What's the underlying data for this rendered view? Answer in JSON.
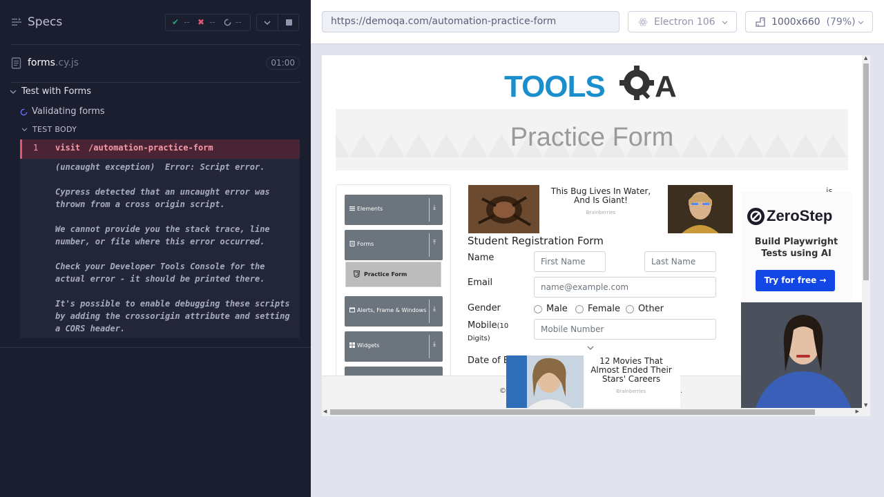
{
  "reporter": {
    "title": "Specs",
    "stats": {
      "passed": "--",
      "failed": "--",
      "pending": "--"
    },
    "spec": {
      "name": "forms",
      "ext": ".cy.js",
      "duration": "01:00"
    },
    "suite": "Test with Forms",
    "test": "Validating forms",
    "test_body": "TEST BODY",
    "command": {
      "number": "1",
      "name": "visit",
      "message": "/automation-practice-form"
    },
    "error_lines": [
      "(uncaught exception)  Error: Script error.",
      "Cypress detected that an uncaught error was\nthrown from a cross origin script.",
      "We cannot provide you the stack trace, line\nnumber, or file where this error occurred.",
      "Check your Developer Tools Console for the\nactual error - it should be printed there.",
      "It's possible to enable debugging these scripts\nby adding the crossorigin attribute and setting\na CORS header."
    ]
  },
  "aut": {
    "url": "https://demoqa.com/automation-practice-form",
    "browser": "Electron 106",
    "viewport": "1000x660",
    "zoom": "(79%)"
  },
  "page": {
    "logo_text": "TOOLSQA",
    "heading": "Practice Form",
    "nav": {
      "elements": "Elements",
      "forms": "Forms",
      "practice_form": "Practice Form",
      "alerts": "Alerts, Frame & Windows",
      "widgets": "Widgets"
    },
    "ads": {
      "bug_title": "This Bug Lives In Water, And Is Giant!",
      "bug_source": "Brainberries",
      "partial_title": "is\ns",
      "movies_title": "12 Movies That Almost Ended Their Stars' Careers",
      "movies_source": "Brainberries",
      "zerostep_name": "ZeroStep",
      "zerostep_tag": "Build Playwright Tests using AI",
      "zerostep_cta": "Try for free →"
    },
    "form": {
      "title": "Student Registration Form",
      "name_label": "Name",
      "first_name_ph": "First Name",
      "last_name_ph": "Last Name",
      "email_label": "Email",
      "email_ph": "name@example.com",
      "gender_label": "Gender",
      "gender_options": [
        "Male",
        "Female",
        "Other"
      ],
      "mobile_label": "Mobile",
      "mobile_hint": "(10",
      "mobile_hint2": "Digits)",
      "mobile_ph": "Mobile Number",
      "dob_label": "Date of B"
    },
    "footer_left": "©",
    "footer_right": "."
  },
  "colors": {
    "accent": "#1247e6",
    "error": "#e45770",
    "pass": "#1fa971"
  }
}
